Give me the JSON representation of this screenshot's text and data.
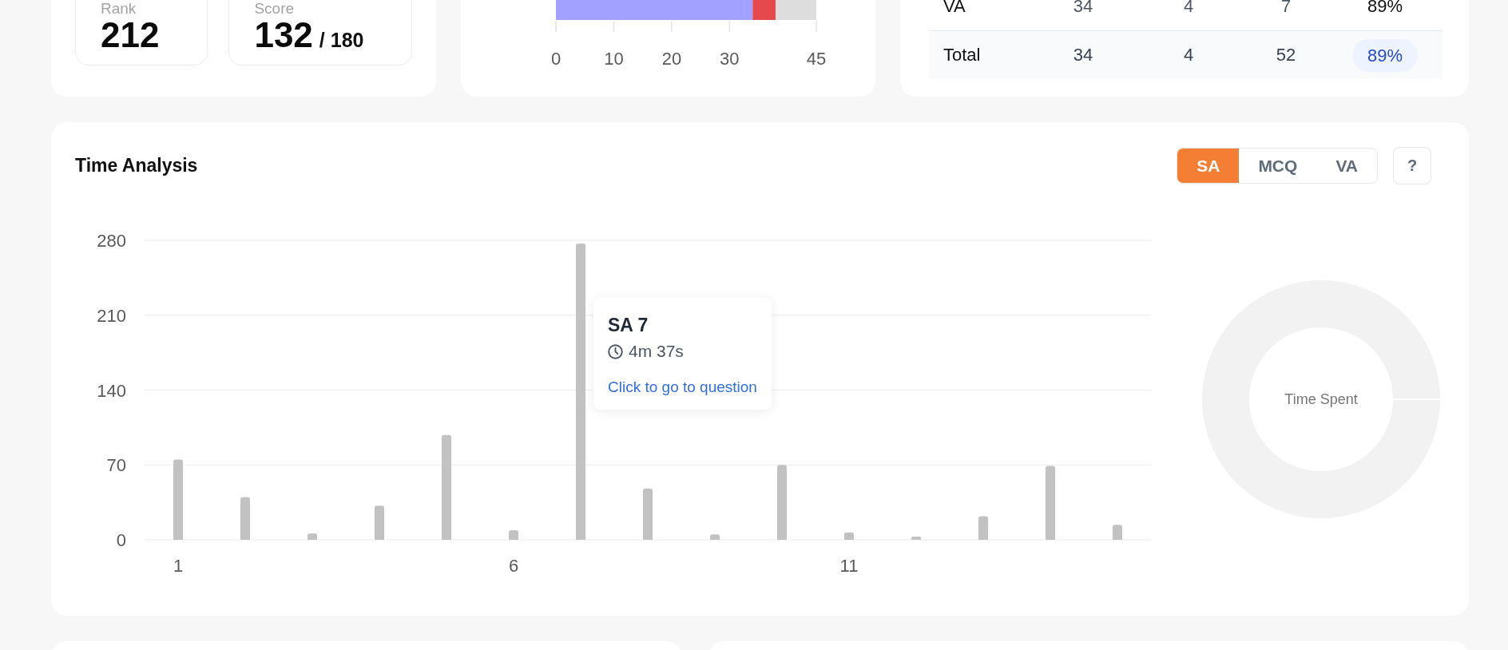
{
  "stats_panel": {
    "stats": [
      {
        "label": "Rank",
        "value": "212"
      },
      {
        "label": "Score",
        "value": "132",
        "suffix": "/ 180"
      }
    ]
  },
  "attempt_chart": {
    "chart_data": {
      "type": "bar",
      "orientation": "horizontal",
      "stacked": true,
      "series": [
        {
          "color": "#a3a1ff",
          "values": [
            34
          ]
        },
        {
          "color": "#e5484d",
          "values": [
            4
          ]
        },
        {
          "color": "#dddddd",
          "values": [
            7
          ]
        }
      ],
      "xlim": [
        0,
        45
      ],
      "xticks": [
        0,
        10,
        20,
        30,
        45
      ]
    }
  },
  "summary_table": {
    "rows": [
      {
        "kind": "row",
        "cells": [
          "VA",
          "34",
          "4",
          "7",
          "89%"
        ]
      },
      {
        "kind": "total",
        "cells": [
          "Total",
          "34",
          "4",
          "52",
          "89%"
        ]
      }
    ]
  },
  "time_analysis": {
    "title": "Time Analysis",
    "segments": [
      {
        "label": "SA",
        "selected": true
      },
      {
        "label": "MCQ",
        "selected": false
      },
      {
        "label": "VA",
        "selected": false
      }
    ],
    "help_button": "?",
    "chart_data": {
      "type": "bar",
      "x": [
        1,
        2,
        3,
        4,
        5,
        6,
        7,
        8,
        9,
        10,
        11,
        12,
        13,
        14,
        15
      ],
      "xlim": [
        0.5,
        15.5
      ],
      "xticks": [
        1,
        6,
        11
      ],
      "series": [
        {
          "color": "#c2c2c2",
          "values": [
            75,
            40,
            6,
            32,
            98,
            9,
            277,
            48,
            5,
            70,
            7,
            3,
            22,
            69,
            14
          ]
        }
      ],
      "ylim": [
        0,
        280
      ],
      "yticks": [
        0,
        70,
        140,
        210,
        280
      ],
      "grid": true
    },
    "tooltip": {
      "title": "SA 7",
      "time": "4m 37s",
      "link": "Click to go to question"
    },
    "donut": {
      "center_label": "Time Spent"
    }
  }
}
